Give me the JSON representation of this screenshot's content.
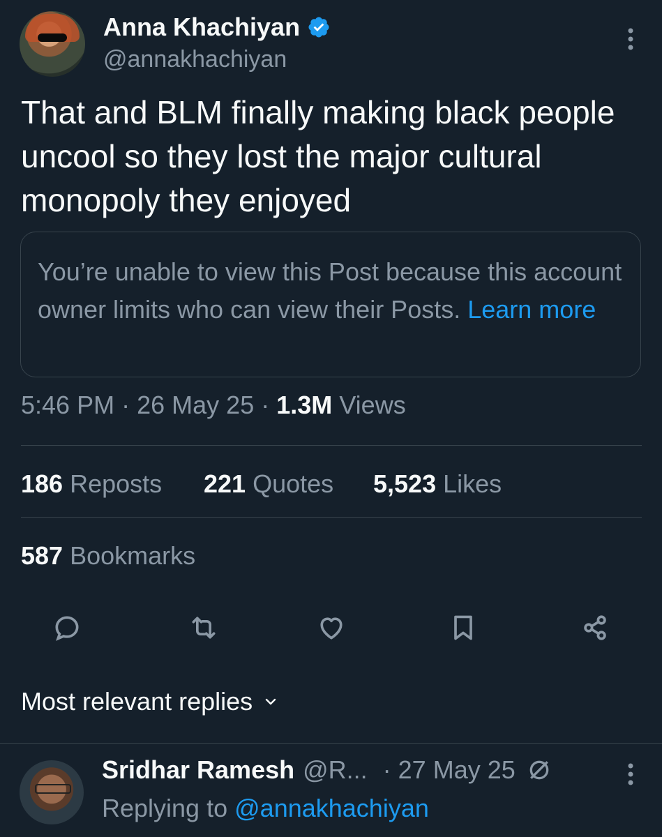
{
  "tweet": {
    "author_name": "Anna Khachiyan",
    "author_handle": "@annakhachiyan",
    "text": "That and BLM finally making black people uncool so they lost the major cultural monopoly they enjoyed",
    "quote_notice": "You’re unable to view this Post because this account owner limits who can view their Posts.",
    "quote_link": "Learn more",
    "time": "5:46 PM",
    "date": "26 May 25",
    "views_count": "1.3M",
    "views_label": "Views",
    "separator": "·"
  },
  "stats": {
    "reposts_count": "186",
    "reposts_label": "Reposts",
    "quotes_count": "221",
    "quotes_label": "Quotes",
    "likes_count": "5,523",
    "likes_label": "Likes",
    "bookmarks_count": "587",
    "bookmarks_label": "Bookmarks"
  },
  "actions": [
    "reply-icon",
    "repost-icon",
    "like-icon",
    "bookmark-icon",
    "share-icon"
  ],
  "replies": {
    "sort_label": "Most relevant replies",
    "items": [
      {
        "name": "Sridhar Ramesh",
        "handle": "@R...",
        "date": "· 27 May 25",
        "replying_prefix": "Replying to",
        "replying_handle": "@annakhachiyan"
      }
    ]
  },
  "colors": {
    "background": "#15202b",
    "text": "#f7f9f9",
    "secondary": "#8b98a5",
    "link": "#1d9bf0",
    "border": "#38444d"
  }
}
